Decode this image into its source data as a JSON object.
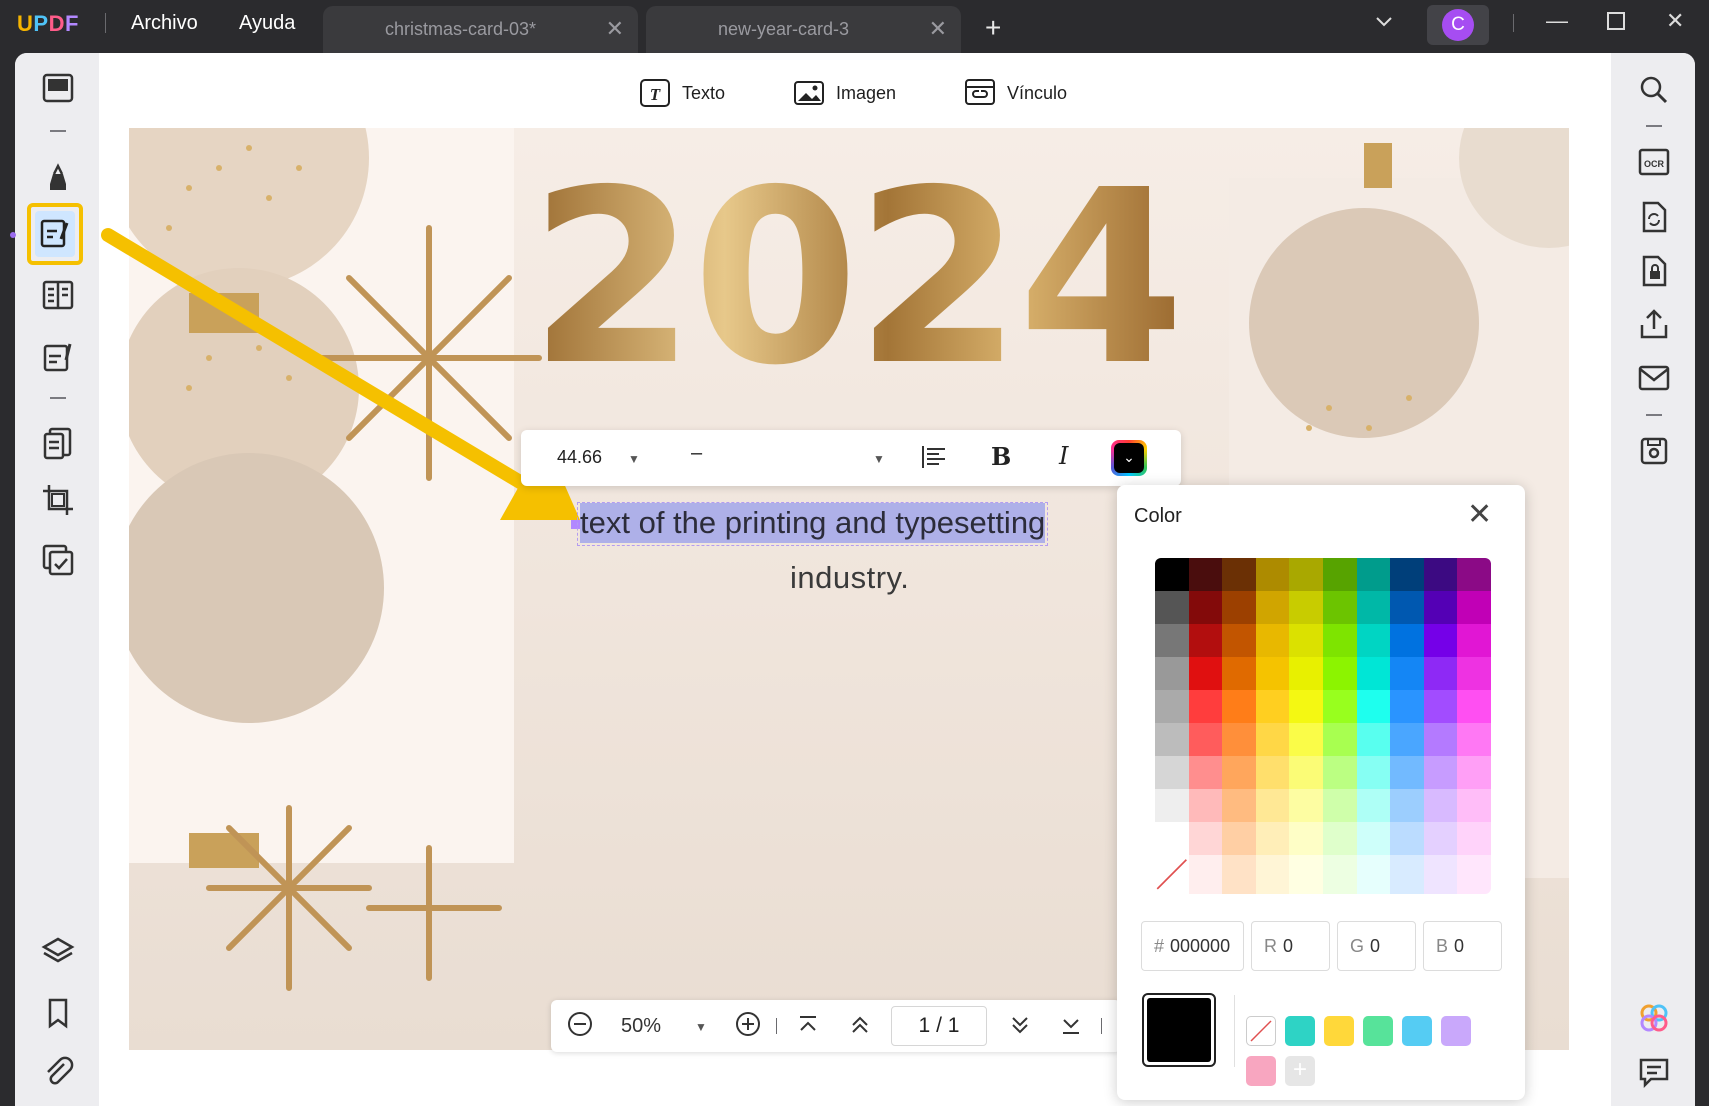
{
  "app": {
    "logo": "UPDF",
    "menu": [
      "Archivo",
      "Ayuda"
    ]
  },
  "tabs": [
    {
      "label": "christmas-card-03*"
    },
    {
      "label": "new-year-card-3"
    }
  ],
  "user": {
    "initial": "C"
  },
  "toolbar": {
    "text_label": "Texto",
    "image_label": "Imagen",
    "link_label": "Vínculo"
  },
  "canvas": {
    "year": "2024",
    "selected_text": "text of the printing and typesetting",
    "line2": "industry."
  },
  "format_bar": {
    "font_size": "44.66",
    "font_name": "–",
    "bold": "B",
    "italic": "I"
  },
  "zoom_bar": {
    "zoom": "50%",
    "page_current": "1",
    "page_sep": "/",
    "page_total": "1"
  },
  "color_panel": {
    "title": "Color",
    "hex_label": "#",
    "hex": "000000",
    "r_label": "R",
    "r": "0",
    "g_label": "G",
    "g": "0",
    "b_label": "B",
    "b": "0",
    "current": "#000000",
    "recent": [
      "none",
      "#2ed3c5",
      "#ffd83a",
      "#57e39a",
      "#55ccf3",
      "#c9a8fb",
      "#f8a6c0"
    ],
    "palette": [
      [
        "#000000",
        "#4a0d0d",
        "#6b3005",
        "#ad8b00",
        "#a9a800",
        "#57a300",
        "#009c8c",
        "#003f7a",
        "#3c0a82",
        "#8b0a86"
      ],
      [
        "#555555",
        "#830a0a",
        "#9c4000",
        "#d0a500",
        "#c8cc00",
        "#6cc400",
        "#00b8a7",
        "#0058b0",
        "#5400b5",
        "#c100b6"
      ],
      [
        "#777777",
        "#b20e0e",
        "#c25500",
        "#e8b800",
        "#dbe100",
        "#7ee400",
        "#00d5c3",
        "#0072e0",
        "#7500e8",
        "#e116d4"
      ],
      [
        "#999999",
        "#e01010",
        "#e06a00",
        "#f5c300",
        "#e8f000",
        "#8cf400",
        "#00e6d6",
        "#1486f5",
        "#8e29f5",
        "#ee32e2"
      ],
      [
        "#aaaaaa",
        "#ff3d3d",
        "#ff7d18",
        "#ffcf20",
        "#f4f812",
        "#98ff1e",
        "#1effee",
        "#2a94ff",
        "#a24cff",
        "#ff4ff2"
      ],
      [
        "#bcbcbc",
        "#ff5c5c",
        "#ff8f3a",
        "#ffd746",
        "#fafc48",
        "#a8ff50",
        "#58ffef",
        "#4aa6ff",
        "#b47aff",
        "#ff78f4"
      ],
      [
        "#d6d6d6",
        "#ff8e8e",
        "#ffa65c",
        "#ffdf6c",
        "#fbfc76",
        "#bbff82",
        "#86fff3",
        "#72baff",
        "#c79cff",
        "#ff9ff6"
      ],
      [
        "#eeeeee",
        "#ffbaba",
        "#ffbb80",
        "#ffe895",
        "#fdfda2",
        "#cfffaa",
        "#aefff6",
        "#9ccefe",
        "#d8baff",
        "#ffbdf8"
      ],
      [
        "#ffffff",
        "#ffd6d6",
        "#ffcfa4",
        "#ffeeb8",
        "#fefec6",
        "#dfffcb",
        "#cefffa",
        "#bbdcff",
        "#e4d0ff",
        "#ffd3fa"
      ],
      [
        "none",
        "#ffeeee",
        "#ffe2c6",
        "#fff5d6",
        "#ffffe2",
        "#edffe2",
        "#e6fffd",
        "#d8ebff",
        "#efe4ff",
        "#ffe6fc"
      ]
    ]
  },
  "colors": {
    "accent": "#f5c000",
    "selection": "#aeb0e8",
    "gold": "#b88a4e"
  }
}
